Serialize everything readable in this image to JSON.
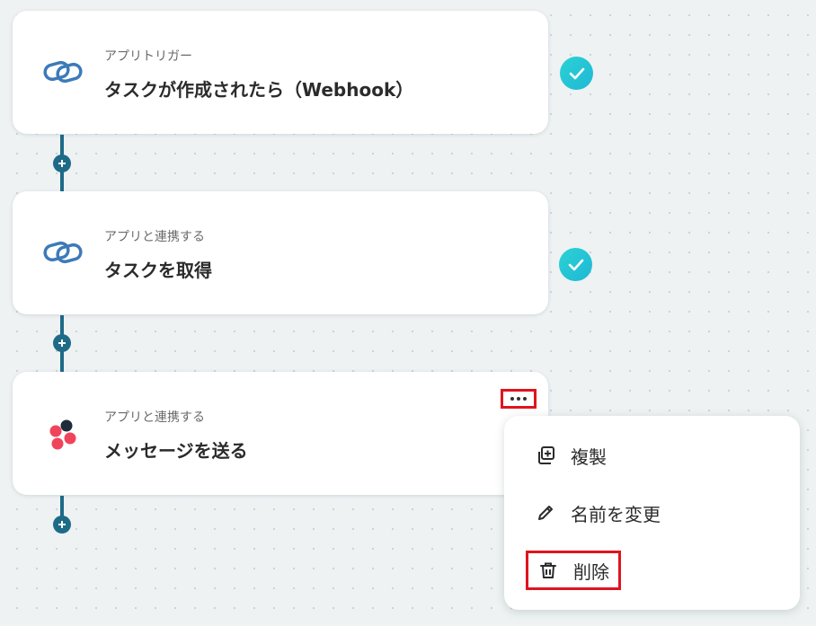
{
  "steps": [
    {
      "subtitle": "アプリトリガー",
      "title": "タスクが作成されたら（Webhook）",
      "icon": "link-rings-icon",
      "status": "completed"
    },
    {
      "subtitle": "アプリと連携する",
      "title": "タスクを取得",
      "icon": "link-rings-icon",
      "status": "completed"
    },
    {
      "subtitle": "アプリと連携する",
      "title": "メッセージを送る",
      "icon": "asana-dots-icon",
      "status": "menu-open"
    }
  ],
  "context_menu": {
    "items": [
      {
        "label": "複製",
        "icon": "duplicate-icon"
      },
      {
        "label": "名前を変更",
        "icon": "pencil-icon"
      },
      {
        "label": "削除",
        "icon": "trash-icon"
      }
    ]
  },
  "colors": {
    "connector": "#1e6b87",
    "check_badge": "#22c4d4",
    "highlight_border": "#e0141e",
    "link_icon": "#3d7ab8"
  }
}
